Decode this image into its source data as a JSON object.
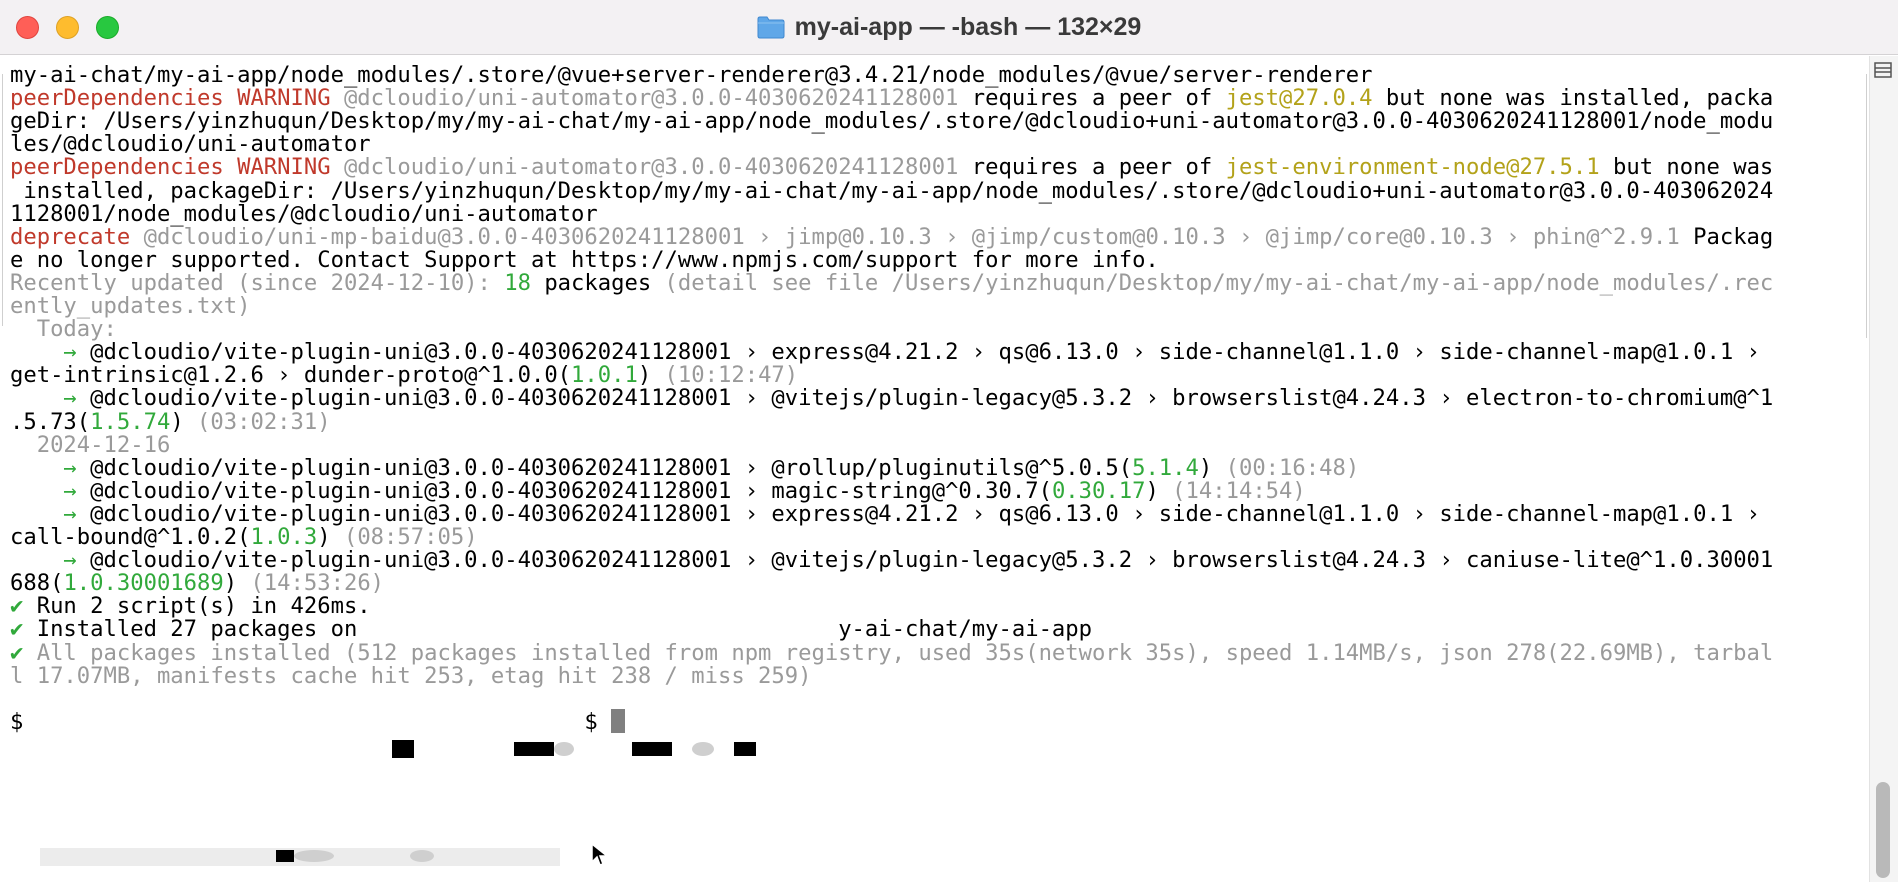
{
  "window": {
    "title": "my-ai-app — -bash — 132×29"
  },
  "terminal": {
    "lines": [
      {
        "segments": [
          {
            "text": "my-ai-chat/my-ai-app/node_modules/.store/@vue+server-renderer@3.4.21/node_modules/@vue/server-renderer",
            "style": "plain"
          }
        ]
      },
      {
        "segments": [
          {
            "text": "peerDependencies WARNING",
            "style": "red"
          },
          {
            "text": " @dcloudio/uni-automator@3.0.0-4030620241128001",
            "style": "grey"
          },
          {
            "text": " requires a peer of ",
            "style": "plain"
          },
          {
            "text": "jest@27.0.4",
            "style": "yellow"
          },
          {
            "text": " but none was installed, packa",
            "style": "plain"
          }
        ]
      },
      {
        "segments": [
          {
            "text": "geDir: /Users/yinzhuqun/Desktop/my/my-ai-chat/my-ai-app/node_modules/.store/@dcloudio+uni-automator@3.0.0-4030620241128001/node_modu",
            "style": "plain"
          }
        ]
      },
      {
        "segments": [
          {
            "text": "les/@dcloudio/uni-automator",
            "style": "plain"
          }
        ]
      },
      {
        "segments": [
          {
            "text": "peerDependencies WARNING",
            "style": "red"
          },
          {
            "text": " @dcloudio/uni-automator@3.0.0-4030620241128001",
            "style": "grey"
          },
          {
            "text": " requires a peer of ",
            "style": "plain"
          },
          {
            "text": "jest-environment-node@27.5.1",
            "style": "yellow"
          },
          {
            "text": " but none was",
            "style": "plain"
          }
        ]
      },
      {
        "segments": [
          {
            "text": " installed, packageDir: /Users/yinzhuqun/Desktop/my/my-ai-chat/my-ai-app/node_modules/.store/@dcloudio+uni-automator@3.0.0-403062024",
            "style": "plain"
          }
        ]
      },
      {
        "segments": [
          {
            "text": "1128001/node_modules/@dcloudio/uni-automator",
            "style": "plain"
          }
        ]
      },
      {
        "segments": [
          {
            "text": "deprecate",
            "style": "red"
          },
          {
            "text": " @dcloudio/uni-mp-baidu@3.0.0-4030620241128001 › jimp@0.10.3 › @jimp/custom@0.10.3 › @jimp/core@0.10.3 › phin@^2.9.1",
            "style": "grey"
          },
          {
            "text": " Packag",
            "style": "plain"
          }
        ]
      },
      {
        "segments": [
          {
            "text": "e no longer supported. Contact Support at https://www.npmjs.com/support for more info.",
            "style": "plain"
          }
        ]
      },
      {
        "segments": [
          {
            "text": "Recently updated (since 2024-12-10): ",
            "style": "grey"
          },
          {
            "text": "18",
            "style": "green"
          },
          {
            "text": " packages",
            "style": "plain"
          },
          {
            "text": " (detail see file /Users/yinzhuqun/Desktop/my/my-ai-chat/my-ai-app/node_modules/.rec",
            "style": "grey"
          }
        ]
      },
      {
        "segments": [
          {
            "text": "ently_updates.txt)",
            "style": "grey"
          }
        ]
      },
      {
        "segments": [
          {
            "text": "  Today:",
            "style": "grey"
          }
        ]
      },
      {
        "segments": [
          {
            "text": "    → ",
            "style": "green"
          },
          {
            "text": "@dcloudio/vite-plugin-uni@3.0.0-4030620241128001 › express@4.21.2 › qs@6.13.0 › side-channel@1.1.0 › side-channel-map@1.0.1 ›",
            "style": "plain"
          }
        ]
      },
      {
        "segments": [
          {
            "text": "get-intrinsic@1.2.6 › dunder-proto@^1.0.0(",
            "style": "plain"
          },
          {
            "text": "1.0.1",
            "style": "green"
          },
          {
            "text": ")",
            "style": "plain"
          },
          {
            "text": " (10:12:47)",
            "style": "grey"
          }
        ]
      },
      {
        "segments": [
          {
            "text": "    → ",
            "style": "green"
          },
          {
            "text": "@dcloudio/vite-plugin-uni@3.0.0-4030620241128001 › @vitejs/plugin-legacy@5.3.2 › browserslist@4.24.3 › electron-to-chromium@^1",
            "style": "plain"
          }
        ]
      },
      {
        "segments": [
          {
            "text": ".5.73(",
            "style": "plain"
          },
          {
            "text": "1.5.74",
            "style": "green"
          },
          {
            "text": ")",
            "style": "plain"
          },
          {
            "text": " (03:02:31)",
            "style": "grey"
          }
        ]
      },
      {
        "segments": [
          {
            "text": "  2024-12-16",
            "style": "grey"
          }
        ]
      },
      {
        "segments": [
          {
            "text": "    → ",
            "style": "green"
          },
          {
            "text": "@dcloudio/vite-plugin-uni@3.0.0-4030620241128001 › @rollup/pluginutils@^5.0.5(",
            "style": "plain"
          },
          {
            "text": "5.1.4",
            "style": "green"
          },
          {
            "text": ")",
            "style": "plain"
          },
          {
            "text": " (00:16:48)",
            "style": "grey"
          }
        ]
      },
      {
        "segments": [
          {
            "text": "    → ",
            "style": "green"
          },
          {
            "text": "@dcloudio/vite-plugin-uni@3.0.0-4030620241128001 › magic-string@^0.30.7(",
            "style": "plain"
          },
          {
            "text": "0.30.17",
            "style": "green"
          },
          {
            "text": ")",
            "style": "plain"
          },
          {
            "text": " (14:14:54)",
            "style": "grey"
          }
        ]
      },
      {
        "segments": [
          {
            "text": "    → ",
            "style": "green"
          },
          {
            "text": "@dcloudio/vite-plugin-uni@3.0.0-4030620241128001 › express@4.21.2 › qs@6.13.0 › side-channel@1.1.0 › side-channel-map@1.0.1 ›",
            "style": "plain"
          }
        ]
      },
      {
        "segments": [
          {
            "text": "call-bound@^1.0.2(",
            "style": "plain"
          },
          {
            "text": "1.0.3",
            "style": "green"
          },
          {
            "text": ")",
            "style": "plain"
          },
          {
            "text": " (08:57:05)",
            "style": "grey"
          }
        ]
      },
      {
        "segments": [
          {
            "text": "    → ",
            "style": "green"
          },
          {
            "text": "@dcloudio/vite-plugin-uni@3.0.0-4030620241128001 › @vitejs/plugin-legacy@5.3.2 › browserslist@4.24.3 › caniuse-lite@^1.0.30001",
            "style": "plain"
          }
        ]
      },
      {
        "segments": [
          {
            "text": "688(",
            "style": "plain"
          },
          {
            "text": "1.0.30001689",
            "style": "green"
          },
          {
            "text": ")",
            "style": "plain"
          },
          {
            "text": " (14:53:26)",
            "style": "grey"
          }
        ]
      },
      {
        "segments": [
          {
            "text": "✔",
            "style": "green"
          },
          {
            "text": " Run 2 script(s) in 426ms.",
            "style": "plain"
          }
        ]
      },
      {
        "segments": [
          {
            "text": "✔",
            "style": "green"
          },
          {
            "text": " Installed 27 packages on ",
            "style": "plain"
          },
          {
            "text": "                                   ",
            "style": "plain"
          },
          {
            "text": "y-ai-chat/my-ai-app",
            "style": "plain"
          }
        ]
      },
      {
        "segments": [
          {
            "text": "✔",
            "style": "green"
          },
          {
            "text": " All packages installed (512 packages installed from npm registry, used 35s(network 35s), speed 1.14MB/s, json 278(22.69MB), tarbal",
            "style": "grey"
          }
        ]
      },
      {
        "segments": [
          {
            "text": "l 17.07MB, manifests cache hit 253, etag hit 238 / miss 259)",
            "style": "grey"
          }
        ]
      },
      {
        "segments": [
          {
            "text": "",
            "style": "plain"
          }
        ]
      },
      {
        "segments": [
          {
            "text": "$                                          $ ",
            "style": "plain"
          }
        ]
      }
    ]
  },
  "colors": {
    "red": "#c0392b",
    "yellow": "#b3a21a",
    "green": "#31a93b",
    "grey": "#9a9a9a"
  },
  "icons": {
    "title": "folder-icon",
    "scrollbar": "split-pane-icon"
  }
}
